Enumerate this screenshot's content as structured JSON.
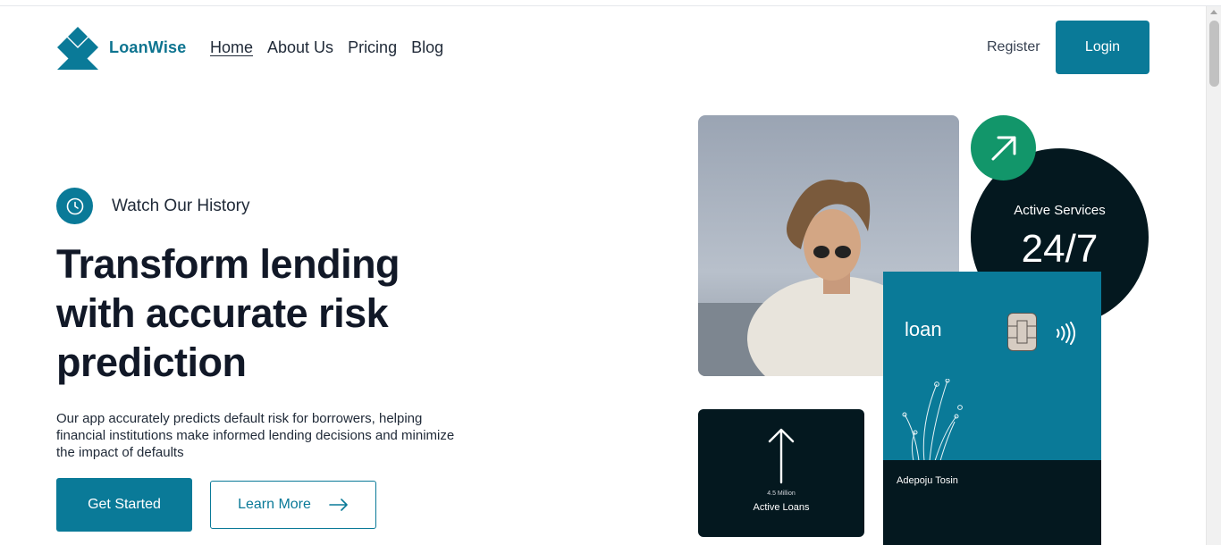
{
  "brand": {
    "name": "LoanWise",
    "accent": "#0a7a98",
    "dark": "#04181f",
    "green": "#12966a"
  },
  "nav": [
    {
      "label": "Home",
      "active": true
    },
    {
      "label": "About Us",
      "active": false
    },
    {
      "label": "Pricing",
      "active": false
    },
    {
      "label": "Blog",
      "active": false
    }
  ],
  "auth": {
    "register": "Register",
    "login": "Login"
  },
  "hero": {
    "history_label": "Watch Our History",
    "headline": "Transform lending with accurate risk prediction",
    "subtext": "Our app accurately predicts default risk for borrowers, helping financial institutions make informed lending decisions and minimize the impact of defaults",
    "get_started": "Get Started",
    "learn_more": "Learn More"
  },
  "stats": {
    "services_label": "Active Services",
    "services_value": "24/7",
    "loans_count": "4.5 Million",
    "loans_label": "Active Loans"
  },
  "card": {
    "title": "loan",
    "holder": "Adepoju Tosin"
  },
  "icons": {
    "logo": "diamond-logo-icon",
    "history": "clock-icon",
    "learn_more": "arrow-right-icon",
    "badge": "arrow-up-right-icon",
    "loans": "arrow-up-icon",
    "card_chip": "chip-icon",
    "card_nfc": "contactless-icon"
  }
}
